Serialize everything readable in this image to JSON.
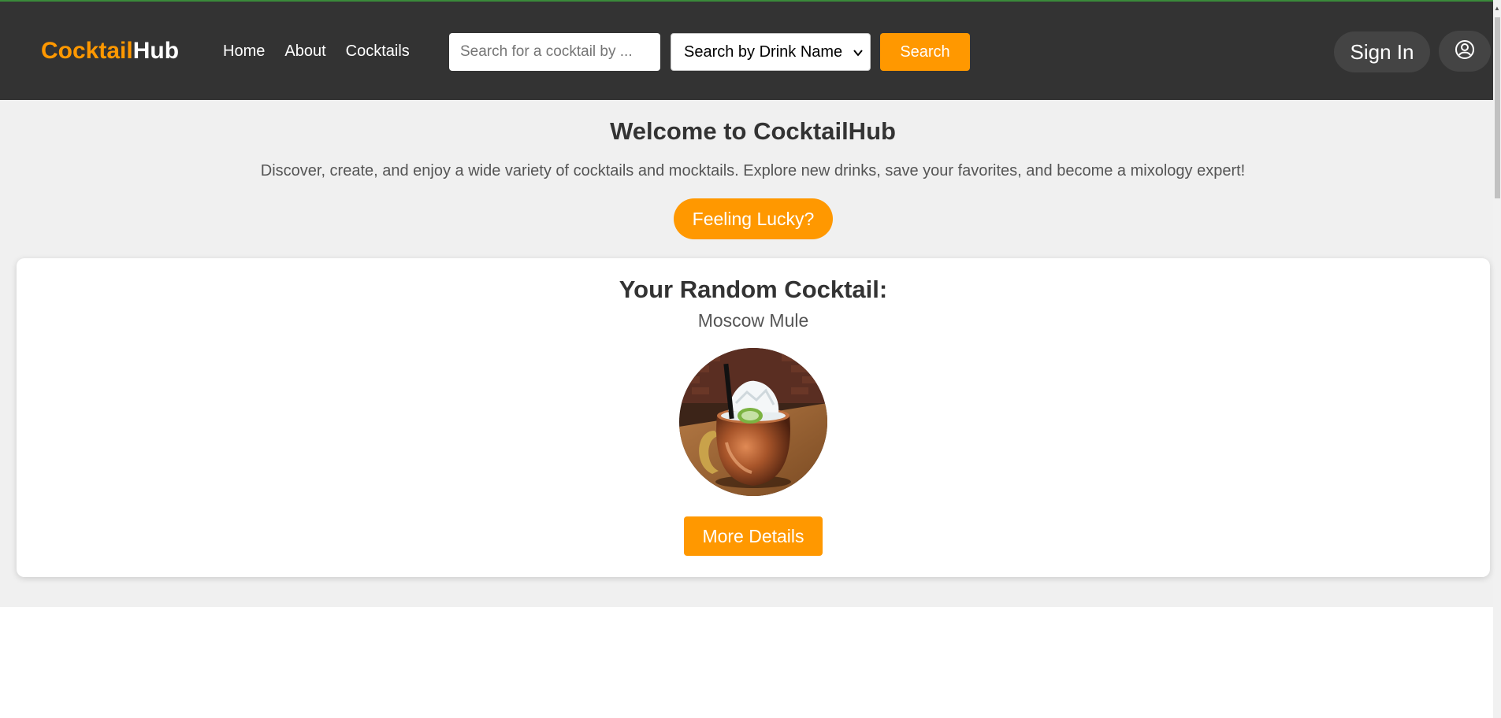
{
  "header": {
    "logo_part1": "Cocktail",
    "logo_part2": "Hub",
    "nav": [
      {
        "label": "Home"
      },
      {
        "label": "About"
      },
      {
        "label": "Cocktails"
      }
    ],
    "search_placeholder": "Search for a cocktail by ...",
    "search_mode_selected": "Search by Drink Name",
    "search_button": "Search",
    "signin_button": "Sign In",
    "profile_icon": "user-circle-icon"
  },
  "hero": {
    "title": "Welcome to CocktailHub",
    "subtitle": "Discover, create, and enjoy a wide variety of cocktails and mocktails. Explore new drinks, save your favorites, and become a mixology expert!",
    "lucky_button": "Feeling Lucky?"
  },
  "random_card": {
    "title": "Your Random Cocktail:",
    "drink_name": "Moscow Mule",
    "details_button": "More Details"
  },
  "colors": {
    "navbar": "#333333",
    "accent": "#ff9800",
    "hero_bg": "#f0f0f0"
  }
}
